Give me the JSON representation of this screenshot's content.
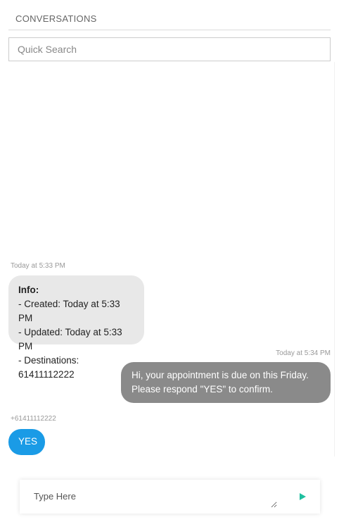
{
  "header": {
    "title": "CONVERSATIONS"
  },
  "search": {
    "placeholder": "Quick Search",
    "value": ""
  },
  "messages": [
    {
      "time": "Today at 5:33 PM",
      "title": "Info:",
      "lines": [
        "- Created: Today at 5:33 PM",
        "- Updated: Today at 5:33 PM",
        "- Destinations: 61411112222"
      ]
    },
    {
      "time": "Today at 5:34 PM",
      "lines": [
        "Hi, your appointment is due on this Friday.",
        "Please respond \"YES\" to confirm."
      ]
    },
    {
      "sender": "+61411112222",
      "text": "YES"
    }
  ],
  "composer": {
    "placeholder": "Type Here",
    "value": ""
  },
  "colors": {
    "info_bubble": "#e8e8e8",
    "outgoing_bubble": "#8a8a8a",
    "incoming_bubble": "#1a9be6",
    "send_icon": "#1fbf9f"
  },
  "icons": {
    "send": "send-icon"
  }
}
